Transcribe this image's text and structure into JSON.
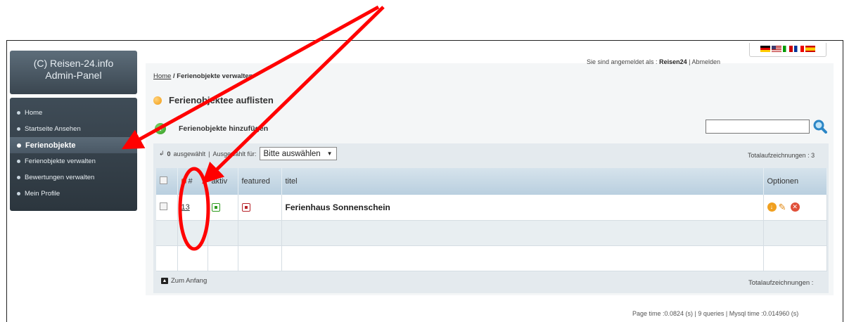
{
  "sidebar": {
    "brand_line1": "(C) Reisen-24.info",
    "brand_line2": "Admin-Panel",
    "items": [
      {
        "label": "Home"
      },
      {
        "label": "Startseite Ansehen"
      },
      {
        "label": "Ferienobjekte",
        "active": true
      },
      {
        "label": "Ferienobjekte verwalten"
      },
      {
        "label": "Bewertungen verwalten"
      },
      {
        "label": "Mein Profile"
      }
    ]
  },
  "header": {
    "logged_in_prefix": "Sie sind angemeldet als :",
    "username": "Reisen24",
    "separator": "|",
    "logout": "Abmelden",
    "flags": [
      "de",
      "us",
      "it",
      "fr",
      "es"
    ]
  },
  "breadcrumb": {
    "home": "Home",
    "separator": "/",
    "current": "Ferienobjekte verwalten"
  },
  "list_title": "Ferienobjektee auflisten",
  "add_label": "Ferienobjekte hinzufügen",
  "search": {
    "value": ""
  },
  "actionbar": {
    "selected_count": "0",
    "selected_text": "ausgewählt",
    "separator": "|",
    "for_text": "Ausgewählt für:",
    "select_value": "Bitte auswählen"
  },
  "total_top": "Totalaufzeichnungen : 3",
  "table": {
    "columns": [
      "#",
      "aktiv",
      "featured",
      "titel",
      "Optionen"
    ],
    "rows": [
      {
        "id": "13",
        "aktiv": true,
        "featured": true,
        "titel": "Ferienhaus Sonnenschein"
      }
    ]
  },
  "footer": {
    "back_to_top": "Zum Anfang",
    "total_bottom": "Totalaufzeichnungen :"
  },
  "page_time": "Page time :0.0824 (s) | 9 queries | Mysql time :0.014960 (s)",
  "colors": {
    "accent": "#2f9b1e",
    "featured_red": "#b8242a",
    "annotation_red": "#ff0000"
  }
}
